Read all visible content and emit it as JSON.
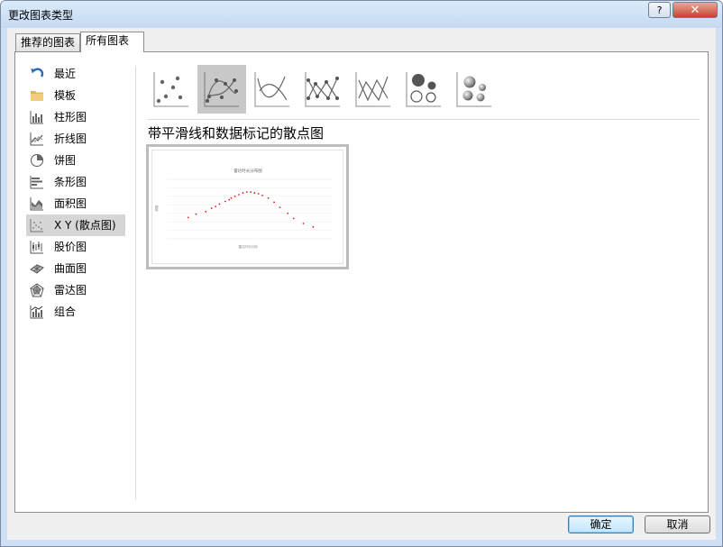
{
  "window": {
    "title": "更改图表类型",
    "help_label": "?",
    "close_label": "✕"
  },
  "tabs": [
    {
      "label": "推荐的图表"
    },
    {
      "label": "所有图表"
    }
  ],
  "sidebar": {
    "items": [
      {
        "label": "最近",
        "icon": "recent-icon"
      },
      {
        "label": "模板",
        "icon": "folder-icon"
      },
      {
        "label": "柱形图",
        "icon": "column-chart-icon"
      },
      {
        "label": "折线图",
        "icon": "line-chart-icon"
      },
      {
        "label": "饼图",
        "icon": "pie-chart-icon"
      },
      {
        "label": "条形图",
        "icon": "bar-chart-icon"
      },
      {
        "label": "面积图",
        "icon": "area-chart-icon"
      },
      {
        "label": "X Y (散点图)",
        "icon": "scatter-chart-icon",
        "selected": true
      },
      {
        "label": "股价图",
        "icon": "stock-chart-icon"
      },
      {
        "label": "曲面图",
        "icon": "surface-chart-icon"
      },
      {
        "label": "雷达图",
        "icon": "radar-chart-icon"
      },
      {
        "label": "组合",
        "icon": "combo-chart-icon"
      }
    ]
  },
  "subtypes": [
    {
      "icon": "scatter-icon"
    },
    {
      "icon": "scatter-smooth-markers-icon",
      "selected": true
    },
    {
      "icon": "scatter-smooth-lines-icon"
    },
    {
      "icon": "scatter-straight-markers-icon"
    },
    {
      "icon": "scatter-straight-lines-icon"
    },
    {
      "icon": "bubble-icon"
    },
    {
      "icon": "3d-bubble-icon"
    }
  ],
  "subtype_title": "带平滑线和数据标记的散点图",
  "preview": {
    "chart_title": "雷达时长分布图",
    "xlabel": "雷达时长分钟",
    "ylabel": "频数",
    "marker_color": "#e01f1f"
  },
  "chart_data": {
    "type": "scatter",
    "x": [
      0.86,
      0.9,
      0.95,
      0.98,
      1.0,
      1.02,
      1.05,
      1.07,
      1.08,
      1.1,
      1.12,
      1.14,
      1.16,
      1.18,
      1.2,
      1.22,
      1.24,
      1.27,
      1.3,
      1.33,
      1.37,
      1.4,
      1.45,
      1.5
    ],
    "y": [
      2.5,
      2.9,
      3.2,
      3.6,
      3.8,
      4.1,
      4.4,
      4.6,
      4.8,
      5.0,
      5.2,
      5.4,
      5.5,
      5.5,
      5.4,
      5.3,
      5.1,
      4.8,
      4.3,
      3.7,
      3.0,
      2.4,
      1.8,
      1.4
    ],
    "xlim": [
      0.75,
      1.6
    ],
    "ylim": [
      0,
      7
    ]
  },
  "buttons": {
    "ok_label": "确定",
    "cancel_label": "取消"
  },
  "colors": {
    "selected_item": "#d6d6d6",
    "selected_subtype": "#c8c8c8"
  }
}
